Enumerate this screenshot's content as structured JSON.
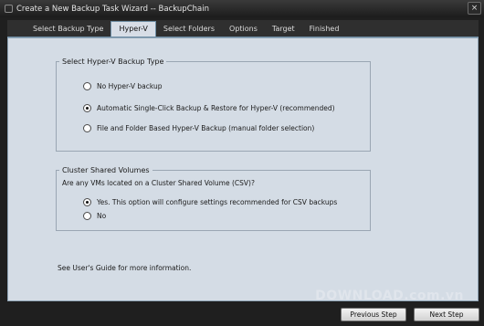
{
  "window": {
    "title": "Create a New Backup Task Wizard -- BackupChain",
    "close_glyph": "×"
  },
  "tabs": [
    {
      "label": "Select Backup Type",
      "active": false
    },
    {
      "label": "Hyper-V",
      "active": true
    },
    {
      "label": "Select Folders",
      "active": false
    },
    {
      "label": "Options",
      "active": false
    },
    {
      "label": "Target",
      "active": false
    },
    {
      "label": "Finished",
      "active": false
    }
  ],
  "backup_type_group": {
    "legend": "Select Hyper-V Backup Type",
    "options": [
      {
        "label": "No Hyper-V backup",
        "checked": false
      },
      {
        "label": "Automatic Single-Click Backup & Restore for Hyper-V (recommended)",
        "checked": true
      },
      {
        "label": "File and Folder Based Hyper-V Backup (manual folder selection)",
        "checked": false
      }
    ]
  },
  "csv_group": {
    "legend": "Cluster Shared Volumes",
    "question": "Are any VMs located on a Cluster Shared Volume (CSV)?",
    "options": [
      {
        "label": "Yes. This option will configure settings recommended for CSV backups",
        "checked": true
      },
      {
        "label": "No",
        "checked": false
      }
    ]
  },
  "guide_text": "See User's Guide for more information.",
  "watermark": "DOWNLOAD.com.vn",
  "buttons": {
    "previous": "Previous Step",
    "next": "Next Step"
  }
}
